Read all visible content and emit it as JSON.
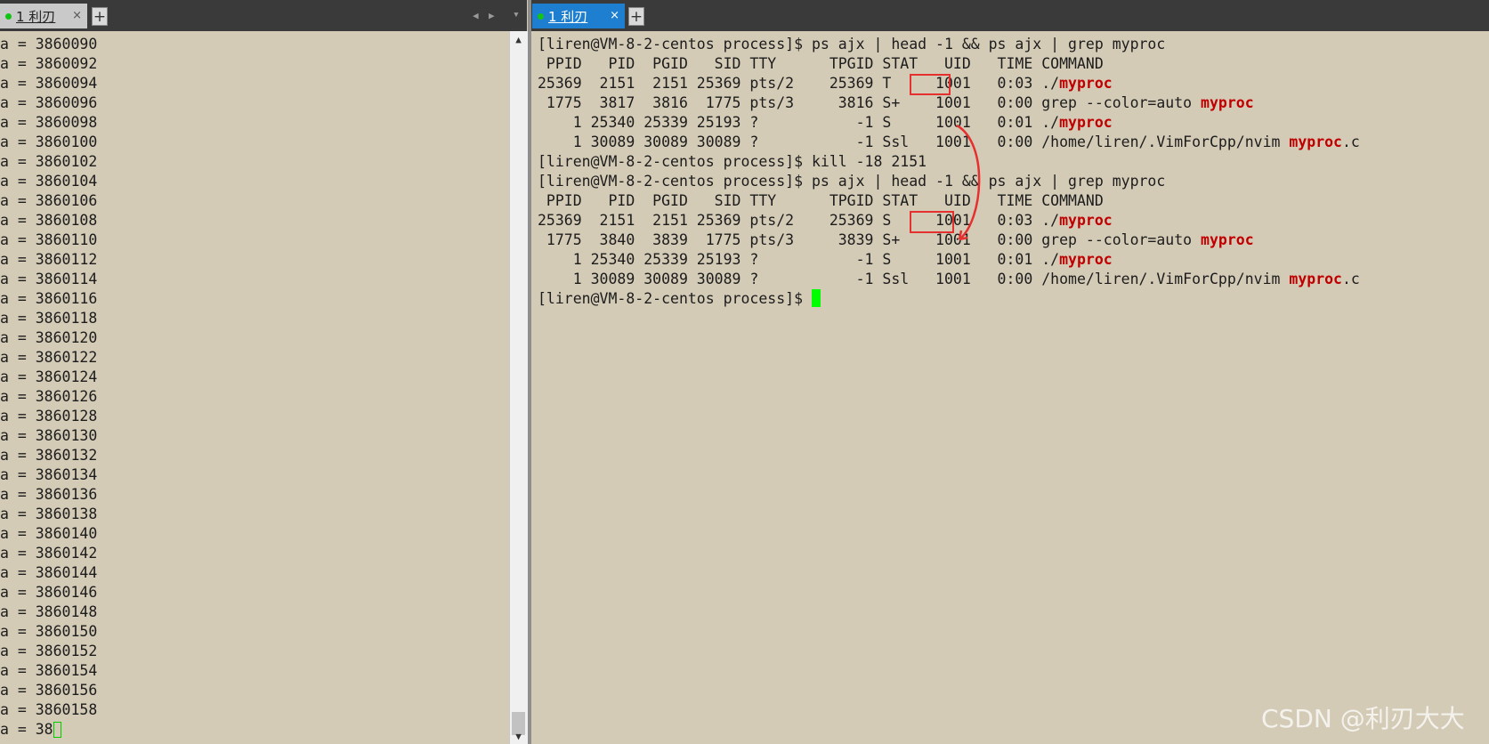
{
  "left_tab": {
    "label": "1 利刃",
    "close": "×",
    "plus": "+"
  },
  "right_tab": {
    "label": "1 利刃",
    "close": "×",
    "plus": "+"
  },
  "tab_nav": {
    "prev": "◀",
    "next": "▶",
    "menu": "▾"
  },
  "left_output": [
    "a = 3860090",
    "a = 3860092",
    "a = 3860094",
    "a = 3860096",
    "a = 3860098",
    "a = 3860100",
    "a = 3860102",
    "a = 3860104",
    "a = 3860106",
    "a = 3860108",
    "a = 3860110",
    "a = 3860112",
    "a = 3860114",
    "a = 3860116",
    "a = 3860118",
    "a = 3860120",
    "a = 3860122",
    "a = 3860124",
    "a = 3860126",
    "a = 3860128",
    "a = 3860130",
    "a = 3860132",
    "a = 3860134",
    "a = 3860136",
    "a = 3860138",
    "a = 3860140",
    "a = 3860142",
    "a = 3860144",
    "a = 3860146",
    "a = 3860148",
    "a = 3860150",
    "a = 3860152",
    "a = 3860154",
    "a = 3860156",
    "a = 3860158"
  ],
  "left_partial": "a = 38",
  "scrollbar": {
    "up": "▲",
    "down": "▼"
  },
  "right_output": [
    [
      {
        "t": "[liren@VM-8-2-centos process]$ ps ajx | head -1 && ps ajx | grep myproc"
      }
    ],
    [
      {
        "t": " PPID   PID  PGID   SID TTY      TPGID STAT   UID   TIME COMMAND"
      }
    ],
    [
      {
        "t": "25369  2151  2151 25369 pts/2    25369 T     1001   0:03 ./"
      },
      {
        "t": "myproc",
        "h": true
      }
    ],
    [
      {
        "t": " 1775  3817  3816  1775 pts/3     3816 S+    1001   0:00 grep --color=auto "
      },
      {
        "t": "myproc",
        "h": true
      }
    ],
    [
      {
        "t": "    1 25340 25339 25193 ?           -1 S     1001   0:01 ./"
      },
      {
        "t": "myproc",
        "h": true
      }
    ],
    [
      {
        "t": "    1 30089 30089 30089 ?           -1 Ssl   1001   0:00 /home/liren/.VimForCpp/nvim "
      },
      {
        "t": "myproc",
        "h": true
      },
      {
        "t": ".c"
      }
    ],
    [
      {
        "t": "[liren@VM-8-2-centos process]$ kill -18 2151"
      }
    ],
    [
      {
        "t": "[liren@VM-8-2-centos process]$ ps ajx | head -1 && ps ajx | grep myproc"
      }
    ],
    [
      {
        "t": " PPID   PID  PGID   SID TTY      TPGID STAT   UID   TIME COMMAND"
      }
    ],
    [
      {
        "t": "25369  2151  2151 25369 pts/2    25369 S     1001   0:03 ./"
      },
      {
        "t": "myproc",
        "h": true
      }
    ],
    [
      {
        "t": " 1775  3840  3839  1775 pts/3     3839 S+    1001   0:00 grep --color=auto "
      },
      {
        "t": "myproc",
        "h": true
      }
    ],
    [
      {
        "t": "    1 25340 25339 25193 ?           -1 S     1001   0:01 ./"
      },
      {
        "t": "myproc",
        "h": true
      }
    ],
    [
      {
        "t": "    1 30089 30089 30089 ?           -1 Ssl   1001   0:00 /home/liren/.VimForCpp/nvim "
      },
      {
        "t": "myproc",
        "h": true
      },
      {
        "t": ".c"
      }
    ]
  ],
  "prompt": "[liren@VM-8-2-centos process]$ ",
  "watermark": "CSDN @利刃大大",
  "colors": {
    "highlight": "#c00000",
    "annotation": "#e53030",
    "cursor": "#00ff00",
    "active_tab": "#1e7fd0"
  }
}
